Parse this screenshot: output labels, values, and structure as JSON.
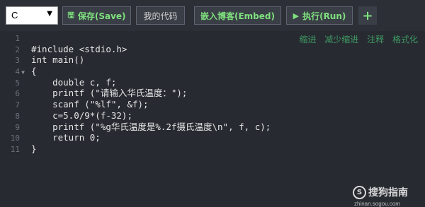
{
  "toolbar": {
    "language": "C",
    "save": "保存(Save)",
    "my_code": "我的代码",
    "embed": "嵌入博客(Embed)",
    "run": "执行(Run)",
    "plus": "+"
  },
  "editor_actions": [
    "缩进",
    "减少缩进",
    "注释",
    "格式化"
  ],
  "code_lines": [
    {
      "n": "1",
      "text": ""
    },
    {
      "n": "2",
      "text": "#include <stdio.h>"
    },
    {
      "n": "3",
      "text": "int main()"
    },
    {
      "n": "4",
      "text": "{"
    },
    {
      "n": "5",
      "text": "    double c, f;"
    },
    {
      "n": "6",
      "text": "    printf (\"请输入华氏温度：\");"
    },
    {
      "n": "7",
      "text": "    scanf (\"%lf\", &f);"
    },
    {
      "n": "8",
      "text": "    c=5.0/9*(f-32);"
    },
    {
      "n": "9",
      "text": "    printf (\"%g华氏温度是%.2f摄氏温度\\n\", f, c);"
    },
    {
      "n": "10",
      "text": "    return 0;"
    },
    {
      "n": "11",
      "text": "}"
    }
  ],
  "watermark": {
    "brand": "搜狗指南",
    "url": "zhinan.sogou.com"
  },
  "colors": {
    "background": "#272a31",
    "button_text": "#7ee07e",
    "action_text": "#3f9a63"
  }
}
